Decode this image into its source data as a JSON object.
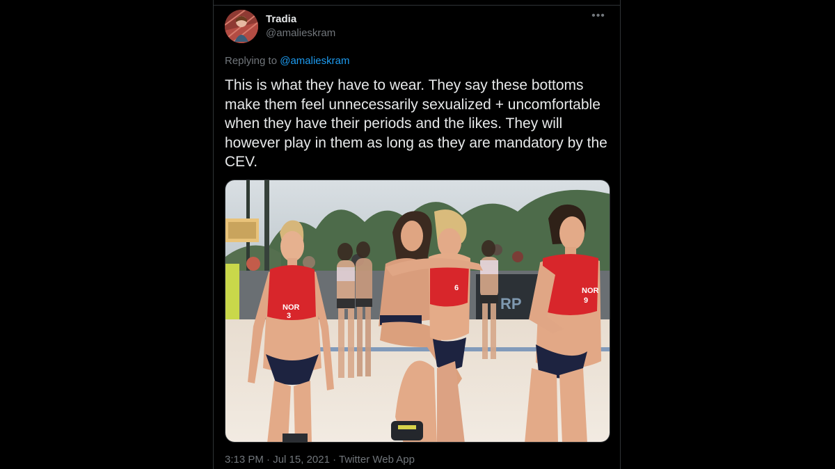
{
  "tweet": {
    "author": {
      "display_name": "Tradia",
      "handle": "@amalieskram"
    },
    "more_icon": "more-horizontal-icon",
    "replying_to": {
      "prefix": "Replying to ",
      "mention": "@amalieskram"
    },
    "text": "This is what they have to wear. They say these bottoms make them feel unnecessarily sexualized + uncomfortable when they have their periods and the likes. They will however play in them as long as they are mandatory by the CEV.",
    "media": {
      "type": "photo",
      "jersey_numbers": [
        "3",
        "6",
        "9"
      ],
      "jersey_text": "NOR",
      "colors": {
        "jersey_red": "#d8262b",
        "bottoms_navy": "#1d2340",
        "sand": "#ece3d6",
        "sky": "#cfd6db"
      }
    },
    "meta": {
      "time": "3:13 PM",
      "separator": " · ",
      "date": "Jul 15, 2021",
      "source": "Twitter Web App"
    }
  },
  "colors": {
    "background": "#000000",
    "primary_text": "#e7e9ea",
    "secondary_text": "#71767b",
    "link": "#1d9bf0",
    "border": "#2f3336"
  }
}
